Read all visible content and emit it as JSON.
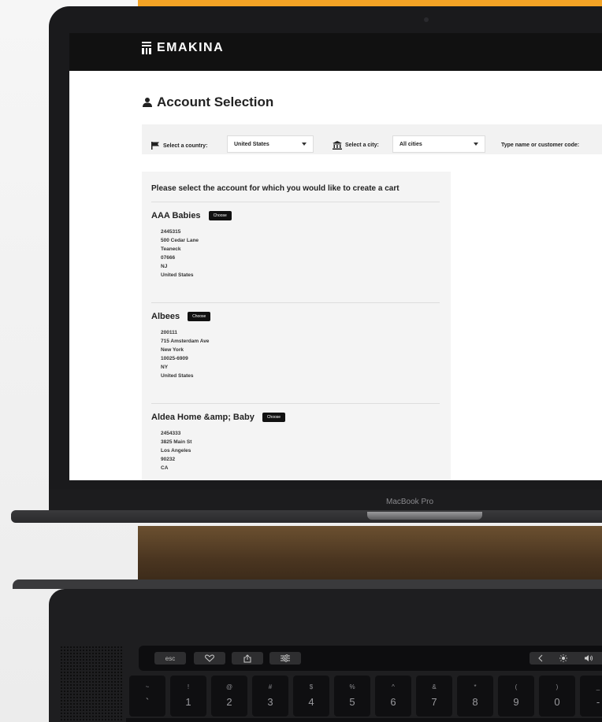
{
  "brand": {
    "name": "EMAKINA"
  },
  "page": {
    "title": "Account Selection"
  },
  "filters": {
    "country_label": "Select a country:",
    "country_value": "United States",
    "city_label": "Select a city:",
    "city_value": "All cities",
    "search_label": "Type name or customer code:"
  },
  "panel": {
    "prompt": "Please select the account for which you would like to create a cart",
    "choose_label": "Choose",
    "accounts": [
      {
        "name": "AAA Babies",
        "lines": [
          "2445315",
          "500 Cedar Lane",
          "Teaneck",
          "07666",
          "NJ",
          "United States"
        ]
      },
      {
        "name": "Albees",
        "lines": [
          "200111",
          "715 Amsterdam Ave",
          "New York",
          "10025-6909",
          "NY",
          "United States"
        ]
      },
      {
        "name": "Aldea Home &amp; Baby",
        "lines": [
          "2454333",
          "3825 Main St",
          "Los Angeles",
          "90232",
          "CA"
        ]
      }
    ]
  },
  "device": {
    "label": "MacBook Pro"
  },
  "touchbar": {
    "esc": "esc",
    "keys": [
      "heart-icon",
      "share-icon",
      "sliders-icon"
    ],
    "right": [
      "chevron-left-icon",
      "brightness-icon",
      "volume-icon"
    ]
  },
  "keyboard": {
    "keys": [
      {
        "top": "~",
        "main": "`"
      },
      {
        "top": "!",
        "main": "1"
      },
      {
        "top": "@",
        "main": "2"
      },
      {
        "top": "#",
        "main": "3"
      },
      {
        "top": "$",
        "main": "4"
      },
      {
        "top": "%",
        "main": "5"
      },
      {
        "top": "^",
        "main": "6"
      },
      {
        "top": "&",
        "main": "7"
      },
      {
        "top": "*",
        "main": "8"
      },
      {
        "top": "(",
        "main": "9"
      },
      {
        "top": ")",
        "main": "0"
      },
      {
        "top": "_",
        "main": "-"
      }
    ]
  }
}
